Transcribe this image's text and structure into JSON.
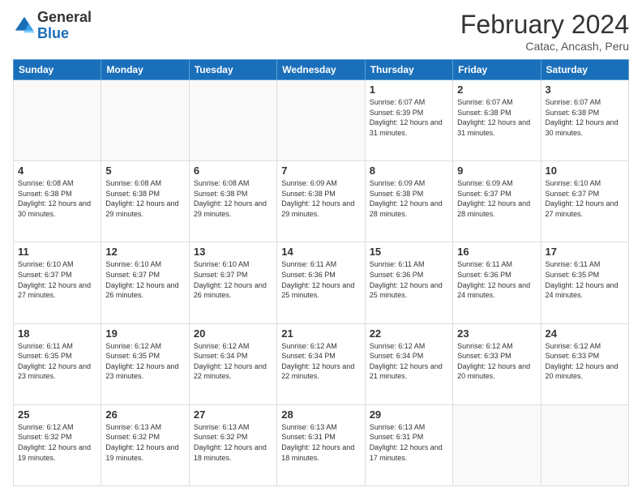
{
  "header": {
    "logo_general": "General",
    "logo_blue": "Blue",
    "month_year": "February 2024",
    "location": "Catac, Ancash, Peru"
  },
  "days_of_week": [
    "Sunday",
    "Monday",
    "Tuesday",
    "Wednesday",
    "Thursday",
    "Friday",
    "Saturday"
  ],
  "weeks": [
    [
      {
        "day": "",
        "info": ""
      },
      {
        "day": "",
        "info": ""
      },
      {
        "day": "",
        "info": ""
      },
      {
        "day": "",
        "info": ""
      },
      {
        "day": "1",
        "info": "Sunrise: 6:07 AM\nSunset: 6:39 PM\nDaylight: 12 hours and 31 minutes."
      },
      {
        "day": "2",
        "info": "Sunrise: 6:07 AM\nSunset: 6:38 PM\nDaylight: 12 hours and 31 minutes."
      },
      {
        "day": "3",
        "info": "Sunrise: 6:07 AM\nSunset: 6:38 PM\nDaylight: 12 hours and 30 minutes."
      }
    ],
    [
      {
        "day": "4",
        "info": "Sunrise: 6:08 AM\nSunset: 6:38 PM\nDaylight: 12 hours and 30 minutes."
      },
      {
        "day": "5",
        "info": "Sunrise: 6:08 AM\nSunset: 6:38 PM\nDaylight: 12 hours and 29 minutes."
      },
      {
        "day": "6",
        "info": "Sunrise: 6:08 AM\nSunset: 6:38 PM\nDaylight: 12 hours and 29 minutes."
      },
      {
        "day": "7",
        "info": "Sunrise: 6:09 AM\nSunset: 6:38 PM\nDaylight: 12 hours and 29 minutes."
      },
      {
        "day": "8",
        "info": "Sunrise: 6:09 AM\nSunset: 6:38 PM\nDaylight: 12 hours and 28 minutes."
      },
      {
        "day": "9",
        "info": "Sunrise: 6:09 AM\nSunset: 6:37 PM\nDaylight: 12 hours and 28 minutes."
      },
      {
        "day": "10",
        "info": "Sunrise: 6:10 AM\nSunset: 6:37 PM\nDaylight: 12 hours and 27 minutes."
      }
    ],
    [
      {
        "day": "11",
        "info": "Sunrise: 6:10 AM\nSunset: 6:37 PM\nDaylight: 12 hours and 27 minutes."
      },
      {
        "day": "12",
        "info": "Sunrise: 6:10 AM\nSunset: 6:37 PM\nDaylight: 12 hours and 26 minutes."
      },
      {
        "day": "13",
        "info": "Sunrise: 6:10 AM\nSunset: 6:37 PM\nDaylight: 12 hours and 26 minutes."
      },
      {
        "day": "14",
        "info": "Sunrise: 6:11 AM\nSunset: 6:36 PM\nDaylight: 12 hours and 25 minutes."
      },
      {
        "day": "15",
        "info": "Sunrise: 6:11 AM\nSunset: 6:36 PM\nDaylight: 12 hours and 25 minutes."
      },
      {
        "day": "16",
        "info": "Sunrise: 6:11 AM\nSunset: 6:36 PM\nDaylight: 12 hours and 24 minutes."
      },
      {
        "day": "17",
        "info": "Sunrise: 6:11 AM\nSunset: 6:35 PM\nDaylight: 12 hours and 24 minutes."
      }
    ],
    [
      {
        "day": "18",
        "info": "Sunrise: 6:11 AM\nSunset: 6:35 PM\nDaylight: 12 hours and 23 minutes."
      },
      {
        "day": "19",
        "info": "Sunrise: 6:12 AM\nSunset: 6:35 PM\nDaylight: 12 hours and 23 minutes."
      },
      {
        "day": "20",
        "info": "Sunrise: 6:12 AM\nSunset: 6:34 PM\nDaylight: 12 hours and 22 minutes."
      },
      {
        "day": "21",
        "info": "Sunrise: 6:12 AM\nSunset: 6:34 PM\nDaylight: 12 hours and 22 minutes."
      },
      {
        "day": "22",
        "info": "Sunrise: 6:12 AM\nSunset: 6:34 PM\nDaylight: 12 hours and 21 minutes."
      },
      {
        "day": "23",
        "info": "Sunrise: 6:12 AM\nSunset: 6:33 PM\nDaylight: 12 hours and 20 minutes."
      },
      {
        "day": "24",
        "info": "Sunrise: 6:12 AM\nSunset: 6:33 PM\nDaylight: 12 hours and 20 minutes."
      }
    ],
    [
      {
        "day": "25",
        "info": "Sunrise: 6:12 AM\nSunset: 6:32 PM\nDaylight: 12 hours and 19 minutes."
      },
      {
        "day": "26",
        "info": "Sunrise: 6:13 AM\nSunset: 6:32 PM\nDaylight: 12 hours and 19 minutes."
      },
      {
        "day": "27",
        "info": "Sunrise: 6:13 AM\nSunset: 6:32 PM\nDaylight: 12 hours and 18 minutes."
      },
      {
        "day": "28",
        "info": "Sunrise: 6:13 AM\nSunset: 6:31 PM\nDaylight: 12 hours and 18 minutes."
      },
      {
        "day": "29",
        "info": "Sunrise: 6:13 AM\nSunset: 6:31 PM\nDaylight: 12 hours and 17 minutes."
      },
      {
        "day": "",
        "info": ""
      },
      {
        "day": "",
        "info": ""
      }
    ]
  ]
}
